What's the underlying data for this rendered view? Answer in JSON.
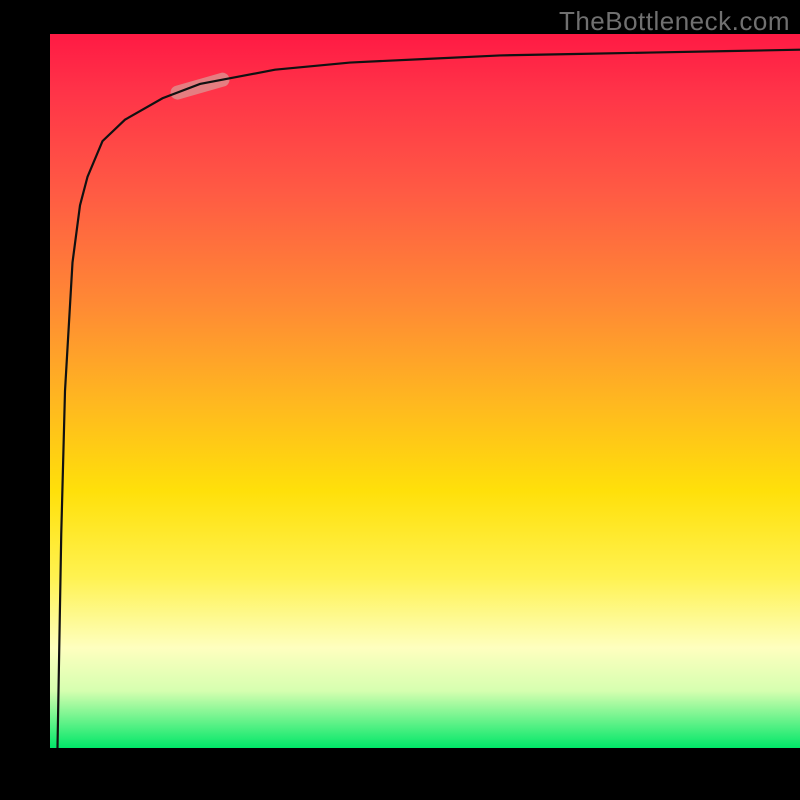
{
  "watermark": "TheBottleneck.com",
  "colors": {
    "frame": "#000000",
    "curve": "#111111",
    "highlight": "rgba(224,140,140,0.85)",
    "watermark_text": "#707070",
    "gradient_top": "#ff1a44",
    "gradient_bottom": "#00e768"
  },
  "chart_data": {
    "type": "line",
    "title": "",
    "xlabel": "",
    "ylabel": "",
    "xlim": [
      0,
      100
    ],
    "ylim": [
      0,
      100
    ],
    "grid": false,
    "legend": false,
    "series": [
      {
        "name": "curve",
        "x": [
          1,
          1.5,
          2,
          3,
          4,
          5,
          7,
          10,
          15,
          20,
          25,
          30,
          40,
          50,
          60,
          70,
          80,
          90,
          100
        ],
        "y": [
          0,
          30,
          50,
          68,
          76,
          80,
          85,
          88,
          91,
          93,
          94,
          95,
          96,
          96.5,
          97,
          97.2,
          97.4,
          97.6,
          97.8
        ]
      }
    ],
    "annotations": [
      {
        "name": "highlight-segment",
        "x_range": [
          17,
          23
        ],
        "y_range": [
          90,
          92
        ]
      }
    ]
  }
}
